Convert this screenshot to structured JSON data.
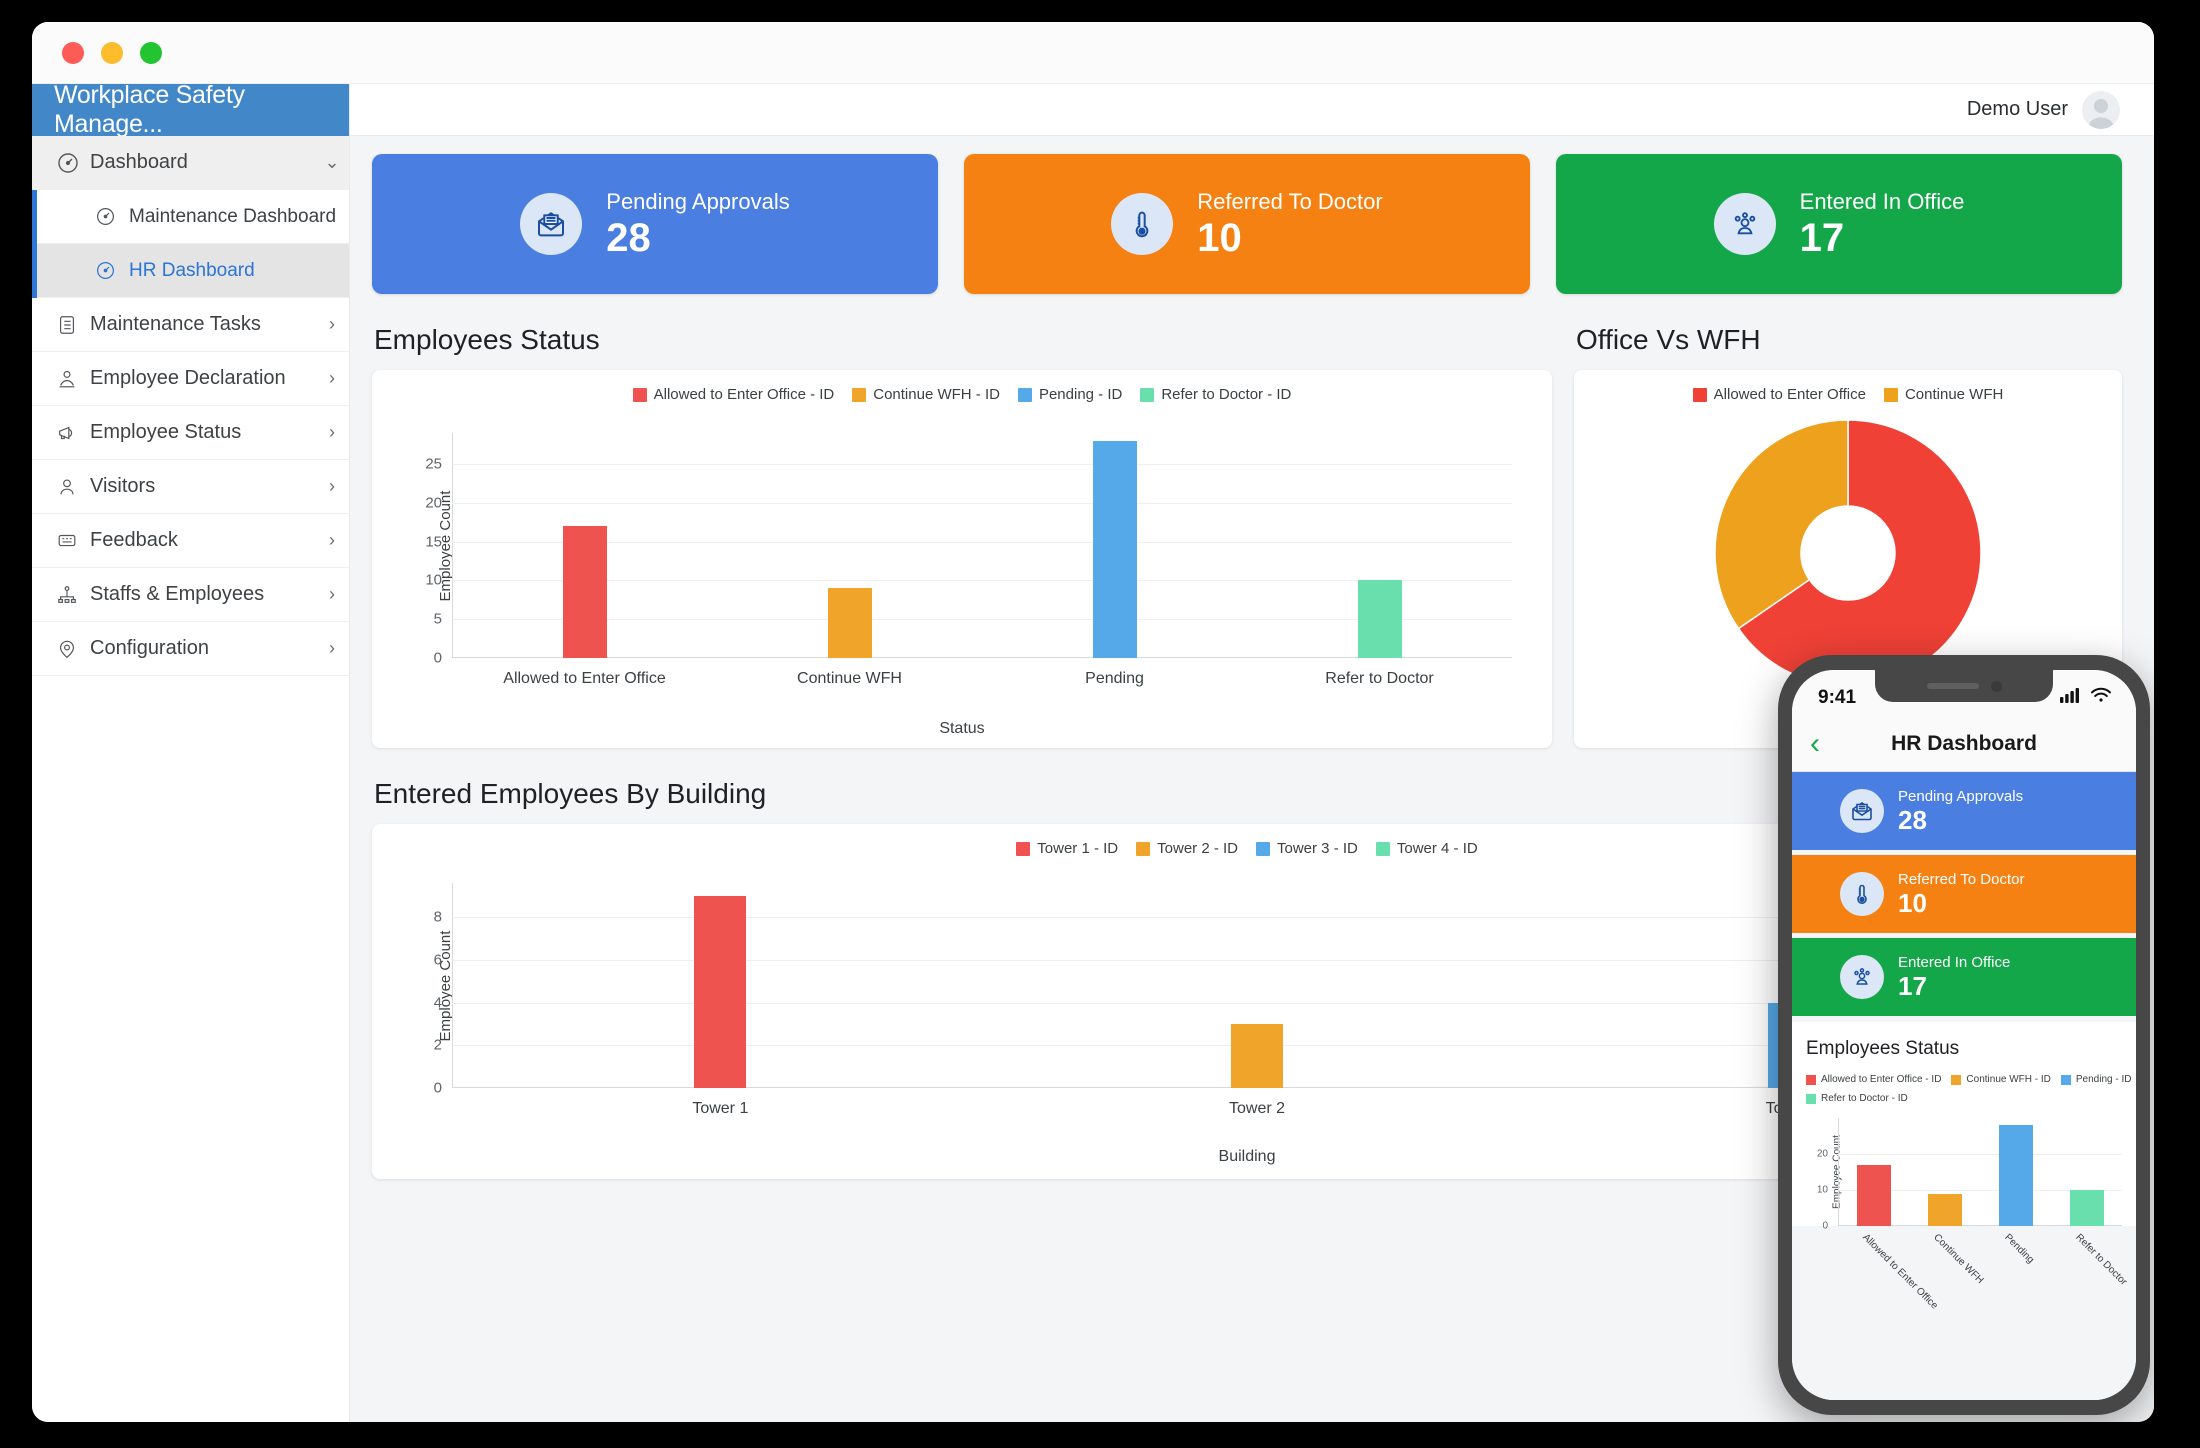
{
  "window": {
    "traffic_lights": [
      "close",
      "minimize",
      "maximize"
    ]
  },
  "sidebar": {
    "brand": "Workplace Safety Manage...",
    "items": [
      {
        "label": "Dashboard",
        "icon": "speedometer-icon",
        "chevron": "chevron-down",
        "active": true
      },
      {
        "label": "Maintenance Dashboard",
        "icon": "speedometer-icon",
        "sub": true
      },
      {
        "label": "HR Dashboard",
        "icon": "speedometer-icon",
        "sub": true,
        "selected": true
      },
      {
        "label": "Maintenance Tasks",
        "icon": "clipboard-list-icon",
        "chevron": "chevron-right"
      },
      {
        "label": "Employee Declaration",
        "icon": "user-badge-icon",
        "chevron": "chevron-right"
      },
      {
        "label": "Employee Status",
        "icon": "megaphone-icon",
        "chevron": "chevron-right"
      },
      {
        "label": "Visitors",
        "icon": "user-icon",
        "chevron": "chevron-right"
      },
      {
        "label": "Feedback",
        "icon": "feedback-icon",
        "chevron": "chevron-right"
      },
      {
        "label": "Staffs & Employees",
        "icon": "org-chart-icon",
        "chevron": "chevron-right"
      },
      {
        "label": "Configuration",
        "icon": "location-gear-icon",
        "chevron": "chevron-right"
      }
    ]
  },
  "topbar": {
    "username": "Demo User",
    "avatar_icon": "user-avatar-icon"
  },
  "stats": [
    {
      "label": "Pending Approvals",
      "value": "28",
      "color": "#4a7ee0",
      "icon": "open-mail-icon"
    },
    {
      "label": "Referred To Doctor",
      "value": "10",
      "color": "#f58113",
      "icon": "thermometer-icon"
    },
    {
      "label": "Entered In Office",
      "value": "17",
      "color": "#13a749",
      "icon": "people-group-icon"
    }
  ],
  "sections": {
    "employees_status": "Employees Status",
    "office_vs_wfh": "Office Vs WFH",
    "entered_by_building": "Entered Employees By Building"
  },
  "chart_data": [
    {
      "id": "employees_status",
      "type": "bar",
      "title": "Employees Status",
      "categories": [
        "Allowed to Enter Office",
        "Continue WFH",
        "Pending",
        "Refer to Doctor"
      ],
      "values": [
        17,
        9,
        28,
        10
      ],
      "colors": [
        "#ef5350",
        "#f0a52a",
        "#55a9e8",
        "#69dfae"
      ],
      "legend": [
        "Allowed to Enter Office - ID",
        "Continue WFH - ID",
        "Pending - ID",
        "Refer to Doctor - ID"
      ],
      "legend_position": "top",
      "xlabel": "Status",
      "ylabel": "Employee Count",
      "yticks": [
        0,
        5,
        10,
        15,
        20,
        25
      ],
      "ylim": [
        0,
        29
      ],
      "grid": true
    },
    {
      "id": "office_vs_wfh",
      "type": "pie",
      "title": "Office Vs WFH",
      "categories": [
        "Allowed to Enter Office",
        "Continue WFH"
      ],
      "values": [
        17,
        9
      ],
      "colors": [
        "#ef4136",
        "#eda11c"
      ],
      "legend": [
        "Allowed to Enter Office",
        "Continue WFH"
      ],
      "legend_position": "top",
      "donut": true
    },
    {
      "id": "entered_employees_by_building",
      "type": "bar",
      "title": "Entered Employees By Building",
      "categories": [
        "Tower 1",
        "Tower 2",
        "Tower 3"
      ],
      "values": [
        9,
        3,
        4
      ],
      "colors": [
        "#ef5350",
        "#f0a52a",
        "#55a9e8"
      ],
      "legend": [
        "Tower 1 - ID",
        "Tower 2 - ID",
        "Tower 3 - ID",
        "Tower 4 - ID"
      ],
      "legend_colors": [
        "#ef5350",
        "#f0a52a",
        "#55a9e8",
        "#69dfae"
      ],
      "legend_position": "top",
      "xlabel": "Building",
      "ylabel": "Employee Count",
      "yticks": [
        0,
        2,
        4,
        6,
        8
      ],
      "ylim": [
        0,
        9.6
      ],
      "grid": true
    }
  ],
  "phone": {
    "status_time": "9:41",
    "signal_icon": "cellular-bars-icon",
    "wifi_icon": "wifi-icon",
    "back_icon": "chevron-left-icon",
    "title": "HR Dashboard",
    "stats": [
      {
        "label": "Pending Approvals",
        "value": "28",
        "color": "#4a7ee0",
        "icon": "open-mail-icon"
      },
      {
        "label": "Referred To Doctor",
        "value": "10",
        "color": "#f58113",
        "icon": "thermometer-icon"
      },
      {
        "label": "Entered In Office",
        "value": "17",
        "color": "#13a749",
        "icon": "people-group-icon"
      }
    ],
    "card_title": "Employees Status",
    "chart": {
      "type": "bar",
      "categories": [
        "Allowed to Enter Office",
        "Continue WFH",
        "Pending",
        "Refer to Doctor"
      ],
      "values": [
        17,
        9,
        28,
        10
      ],
      "colors": [
        "#ef5350",
        "#f0a52a",
        "#55a9e8",
        "#69dfae"
      ],
      "legend": [
        "Allowed to Enter Office - ID",
        "Continue WFH - ID",
        "Pending - ID",
        "Refer to Doctor - ID"
      ],
      "ylabel": "Employee Count",
      "yticks": [
        0,
        10,
        20
      ]
    }
  }
}
